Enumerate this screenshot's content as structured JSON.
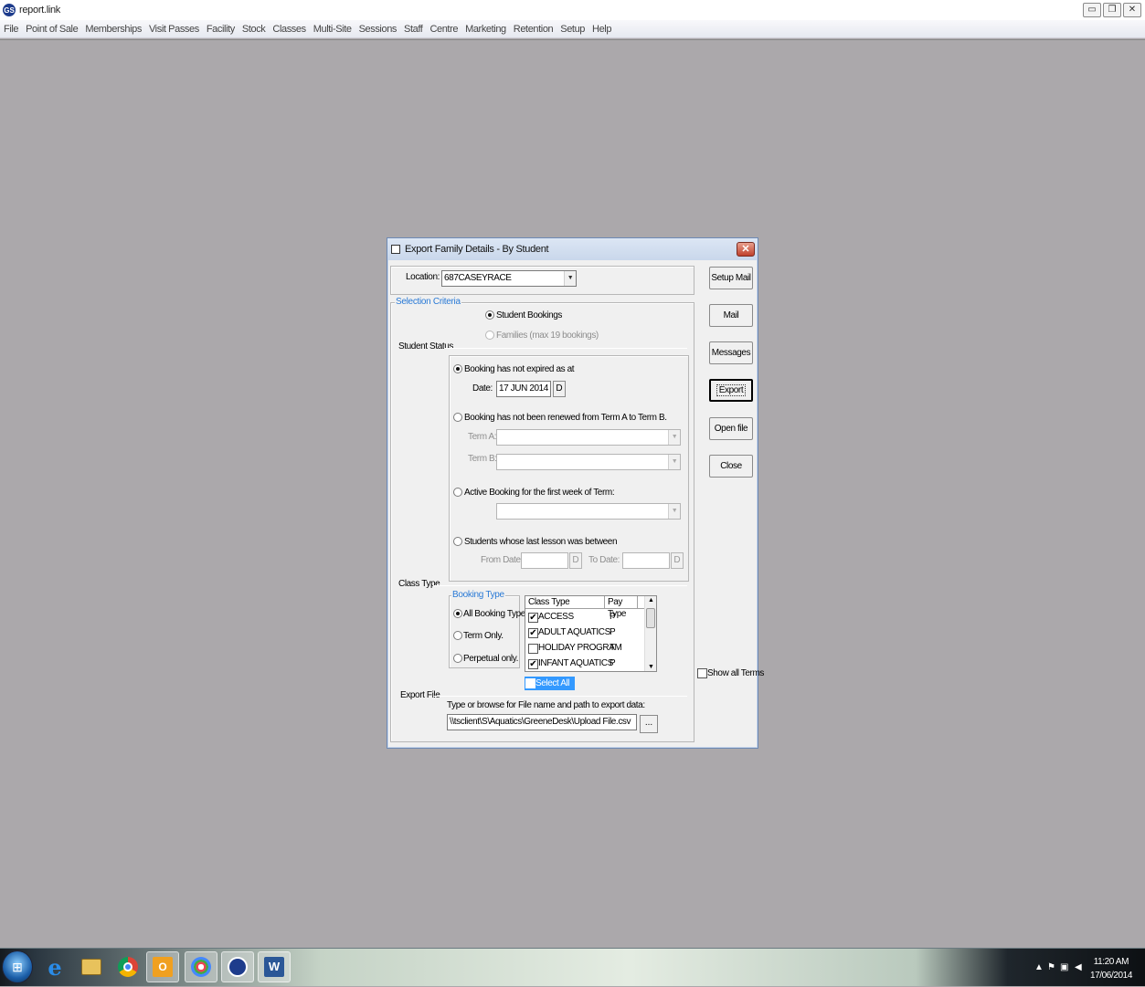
{
  "app": {
    "title": "report.link",
    "icon_text": "GS"
  },
  "window_controls": {
    "minimize": "▭",
    "restore": "❐",
    "close": "✕"
  },
  "menu": [
    "File",
    "Point of Sale",
    "Memberships",
    "Visit Passes",
    "Facility",
    "Stock",
    "Classes",
    "Multi-Site",
    "Sessions",
    "Staff",
    "Centre",
    "Marketing",
    "Retention",
    "Setup",
    "Help"
  ],
  "dialog": {
    "title": "Export Family Details - By Student",
    "close_glyph": "✕",
    "location_label": "Location:",
    "location_value": "687CASEYRACE",
    "selection_criteria_legend": "Selection Criteria",
    "student_bookings": "Student Bookings",
    "families": "Families (max 19 bookings)",
    "student_status_label": "Student Status",
    "opt_not_expired": "Booking has not expired  as at",
    "date_label": "Date:",
    "date_value": "17 JUN 2014",
    "d_button": "D",
    "opt_not_renewed": "Booking has not been renewed from Term A to Term B.",
    "term_a_label": "Term A:",
    "term_b_label": "Term B:",
    "term_a_value": "",
    "term_b_value": "",
    "opt_active_first_week": "Active Booking for the first week of Term:",
    "first_week_term_value": "",
    "opt_last_lesson": "Students whose last lesson was between",
    "from_date_label": "From Date:",
    "to_date_label": "To Date:",
    "from_date_value": "",
    "to_date_value": "",
    "class_type_label": "Class Type",
    "booking_type_legend": "Booking Type",
    "bt_all": "All Booking Types.",
    "bt_term": "Term Only.",
    "bt_perpetual": "Perpetual only.",
    "list_headers": {
      "class_type": "Class Type",
      "pay_type": "Pay Type"
    },
    "class_types": [
      {
        "name": "ACCESS",
        "pay": "P",
        "checked": true
      },
      {
        "name": "ADULT AQUATICS",
        "pay": "P",
        "checked": true
      },
      {
        "name": "HOLIDAY PROGRAM",
        "pay": "T",
        "checked": false
      },
      {
        "name": "INFANT AQUATICS",
        "pay": "P",
        "checked": true
      }
    ],
    "select_all": "Select All",
    "show_all_terms": "Show all Terms",
    "export_file_label": "Export File",
    "export_hint": "Type or browse for File name and path to export data:",
    "export_path": "\\\\tsclient\\S\\Aquatics\\GreeneDesk\\Upload File.csv",
    "browse_button": "...",
    "buttons": {
      "setup_mail": "Setup Mail",
      "mail": "Mail",
      "messages": "Messages",
      "export": "Export",
      "open_file": "Open file",
      "close": "Close"
    }
  },
  "taskbar": {
    "time": "11:20 AM",
    "date": "17/06/2014",
    "icons": [
      "start-orb",
      "internet-explorer",
      "file-explorer",
      "chrome",
      "outlook",
      "paint",
      "report-link",
      "word"
    ]
  }
}
